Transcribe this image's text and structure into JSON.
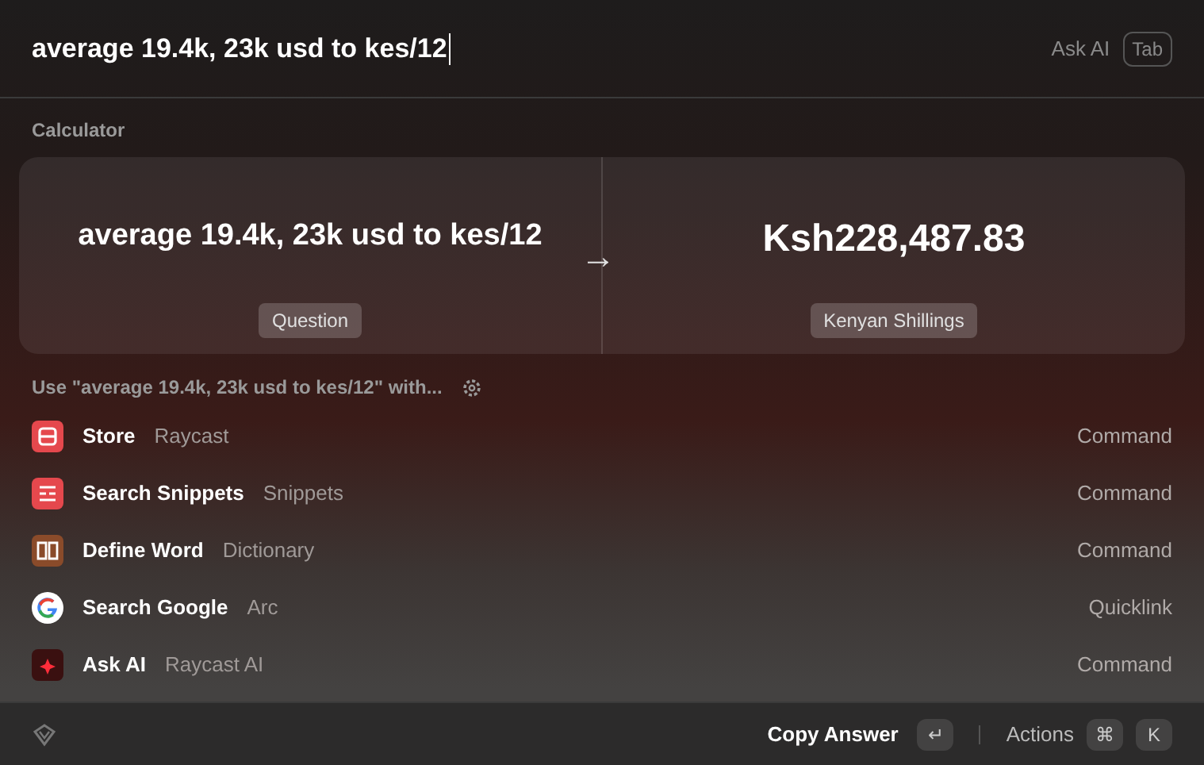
{
  "search": {
    "value": "average 19.4k, 23k usd to kes/12",
    "ask_ai": "Ask AI",
    "tab_key": "Tab"
  },
  "section": "Calculator",
  "calculator": {
    "question": "average 19.4k, 23k usd to kes/12",
    "arrow": "→",
    "answer": "Ksh228,487.83",
    "question_label": "Question",
    "answer_label": "Kenyan Shillings"
  },
  "use_with": "Use \"average 19.4k, 23k usd to kes/12\" with...",
  "results": [
    {
      "kind": "store",
      "title": "Store",
      "subtitle": "Raycast",
      "type": "Command"
    },
    {
      "kind": "snippets",
      "title": "Search Snippets",
      "subtitle": "Snippets",
      "type": "Command"
    },
    {
      "kind": "dictionary",
      "title": "Define Word",
      "subtitle": "Dictionary",
      "type": "Command"
    },
    {
      "kind": "google",
      "title": "Search Google",
      "subtitle": "Arc",
      "type": "Quicklink"
    },
    {
      "kind": "ai",
      "title": "Ask AI",
      "subtitle": "Raycast AI",
      "type": "Command"
    }
  ],
  "footer": {
    "primary": "Copy Answer",
    "enter_key": "↵",
    "actions": "Actions",
    "keys": [
      "⌘",
      "K"
    ]
  }
}
